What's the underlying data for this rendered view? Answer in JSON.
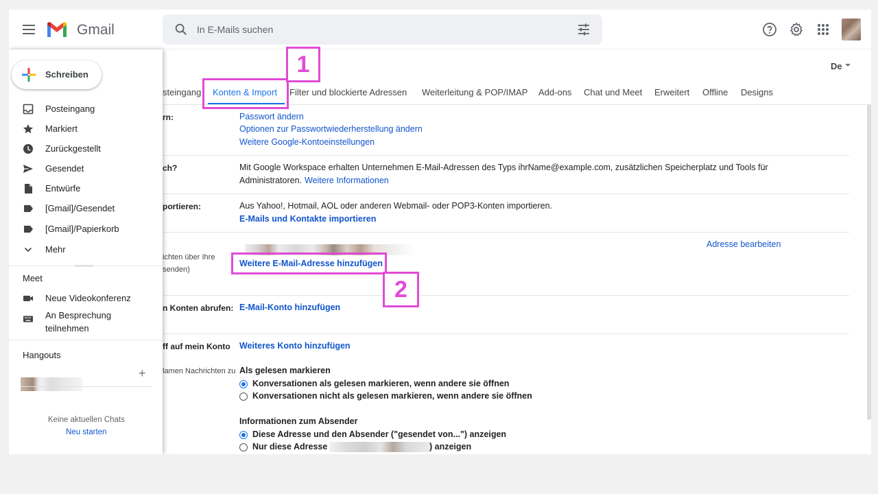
{
  "header": {
    "app_name": "Gmail",
    "search_placeholder": "In E-Mails suchen"
  },
  "sidebar": {
    "compose_label": "Schreiben",
    "items": [
      {
        "label": "Posteingang",
        "icon": "inbox-icon"
      },
      {
        "label": "Markiert",
        "icon": "star-icon"
      },
      {
        "label": "Zurückgestellt",
        "icon": "clock-icon"
      },
      {
        "label": "Gesendet",
        "icon": "send-icon"
      },
      {
        "label": "Entwürfe",
        "icon": "draft-icon"
      },
      {
        "label": "[Gmail]/Gesendet",
        "icon": "label-icon"
      },
      {
        "label": "[Gmail]/Papierkorb",
        "icon": "label-icon"
      },
      {
        "label": "Mehr",
        "icon": "chevron-down-icon"
      }
    ],
    "meet": {
      "title": "Meet",
      "items": [
        {
          "label": "Neue Videokonferenz",
          "icon": "video-icon"
        },
        {
          "label_line1": "An Besprechung",
          "label_line2": "teilnehmen",
          "icon": "keyboard-icon"
        }
      ]
    },
    "hangouts": {
      "title": "Hangouts",
      "no_chats": "Keine aktuellen Chats",
      "restart": "Neu starten"
    }
  },
  "content": {
    "language": "De",
    "tabs": [
      {
        "label": "steingang",
        "active": false
      },
      {
        "label": "Konten & Import",
        "active": true
      },
      {
        "label": "Filter und blockierte Adressen",
        "active": false
      },
      {
        "label": "Weiterleitung & POP/IMAP",
        "active": false
      },
      {
        "label": "Add-ons",
        "active": false
      },
      {
        "label": "Chat und Meet",
        "active": false
      },
      {
        "label": "Erweitert",
        "active": false
      },
      {
        "label": "Offline",
        "active": false
      },
      {
        "label": "Designs",
        "active": false
      }
    ],
    "rows": {
      "r1_label": "rn:",
      "r1_links": [
        "Passwort ändern",
        "Optionen zur Passwortwiederherstellung ändern",
        "Weitere Google-Kontoeinstellungen"
      ],
      "r2_label": "ch?",
      "r2_text": "Mit Google Workspace erhalten Unternehmen E-Mail-Adressen des Typs ihrName@example.com, zusätzlichen Speicherplatz und Tools für",
      "r2_text2": "Administratoren.",
      "r2_link": "Weitere Informationen",
      "r3_label": "portieren:",
      "r3_text": "Aus Yahoo!, Hotmail, AOL oder anderen Webmail- oder POP3-Konten importieren.",
      "r3_link": "E-Mails und Kontakte importieren",
      "r4_label1": "ichten über Ihre",
      "r4_label2": "senden)",
      "r4_edit": "Adresse bearbeiten",
      "r4_add": "Weitere E-Mail-Adresse hinzufügen",
      "r5_label": "n Konten abrufen:",
      "r5_link": "E-Mail-Konto hinzufügen",
      "r6_label": "ff auf mein Konto",
      "r6_link": "Weiteres Konto hinzufügen",
      "r7_label": "lamen Nachrichten zu",
      "r7_heading": "Als gelesen markieren",
      "r7_opt1": "Konversationen als gelesen markieren, wenn andere sie öffnen",
      "r7_opt2": "Konversationen nicht als gelesen markieren, wenn andere sie öffnen",
      "r8_heading": "Informationen zum Absender",
      "r8_opt1": "Diese Adresse und den Absender (\"gesendet von...\") anzeigen",
      "r8_opt2_pre": "Nur diese Adresse (",
      "r8_opt2_post": ") anzeigen"
    }
  },
  "annotations": [
    "1",
    "2"
  ],
  "colors": {
    "accent": "#1a73e8",
    "link": "#1155cc",
    "annotation": "#e24bd6"
  }
}
